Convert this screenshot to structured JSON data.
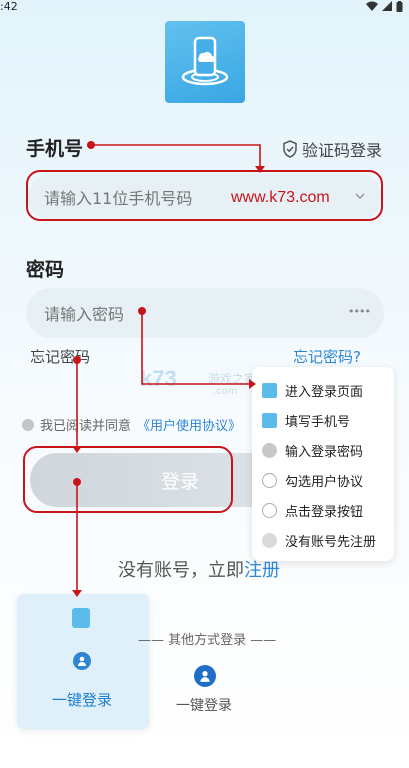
{
  "status": {
    "time": ":42"
  },
  "icons": {
    "logo": "phone-cloud-icon",
    "shield": "shield-check-icon",
    "chevron": "chevron-down-icon",
    "eye": "eye-hidden-icon",
    "user": "user-icon"
  },
  "login": {
    "phone_label": "手机号",
    "sms_login": "验证码登录",
    "phone_placeholder": "请输入11位手机号码",
    "watermark_url": "www.k73.com",
    "password_label": "密码",
    "password_placeholder": "请输入密码",
    "password_mask": "••••",
    "forgot_left": "忘记密码",
    "forgot_right": "忘记密码?",
    "agree_prefix": "我已阅读并同意",
    "agree_link": "《用户使用协议》",
    "agree_link2": "《",
    "button": "登录",
    "register_prefix": "没有账号，立即",
    "register_link": "注册",
    "other_methods": "—— 其他方式登录 ——",
    "onekey_card": "一键登录",
    "onekey_plain": "一键登录"
  },
  "watermark": {
    "k73": "k73",
    "cn": "游戏之家",
    "com": ".com"
  },
  "legend": [
    {
      "text": "进入登录页面",
      "icon": "login-page-icon"
    },
    {
      "text": "填写手机号",
      "icon": "phone-icon"
    },
    {
      "text": "输入登录密码",
      "icon": "password-icon"
    },
    {
      "text": "勾选用户协议",
      "icon": "checkbox-icon"
    },
    {
      "text": "点击登录按钮",
      "icon": "click-icon"
    },
    {
      "text": "没有账号先注册",
      "icon": "register-icon"
    }
  ],
  "colors": {
    "accent": "#2e86d6",
    "annotation": "#c8151a",
    "logo_bg": "#45aee8"
  }
}
